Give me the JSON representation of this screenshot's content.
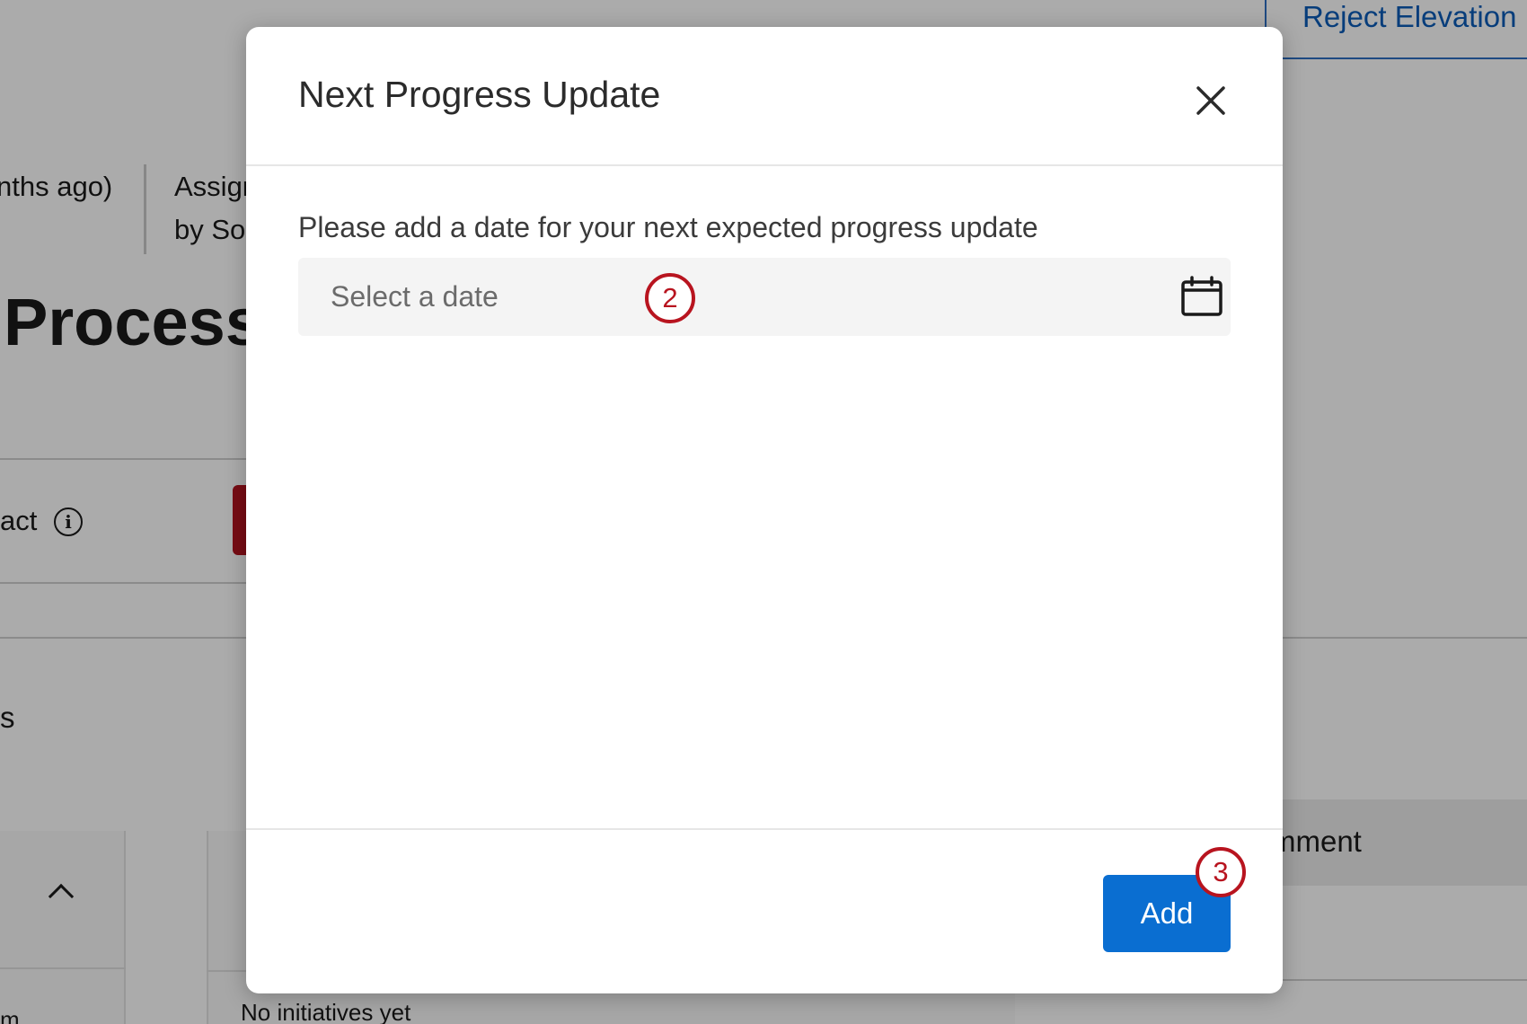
{
  "background": {
    "reject_button_label": "Reject Elevation",
    "months_text": "nths ago)",
    "assign_text": "Assign",
    "by_text": "by So",
    "process_title": "Process",
    "impact_label": "act",
    "info_glyph": "i",
    "s_text": "s",
    "m_text": "m",
    "no_initiatives_text": "No initiatives yet",
    "comment_text": "mment"
  },
  "modal": {
    "title": "Next Progress Update",
    "field_label": "Please add a date for your next expected progress update",
    "date_placeholder": "Select a date",
    "date_value": "",
    "add_label": "Add",
    "colors": {
      "primary": "#0a6ed1",
      "marker": "#b8141f"
    }
  },
  "annotations": {
    "step_2": "2",
    "step_3": "3"
  }
}
